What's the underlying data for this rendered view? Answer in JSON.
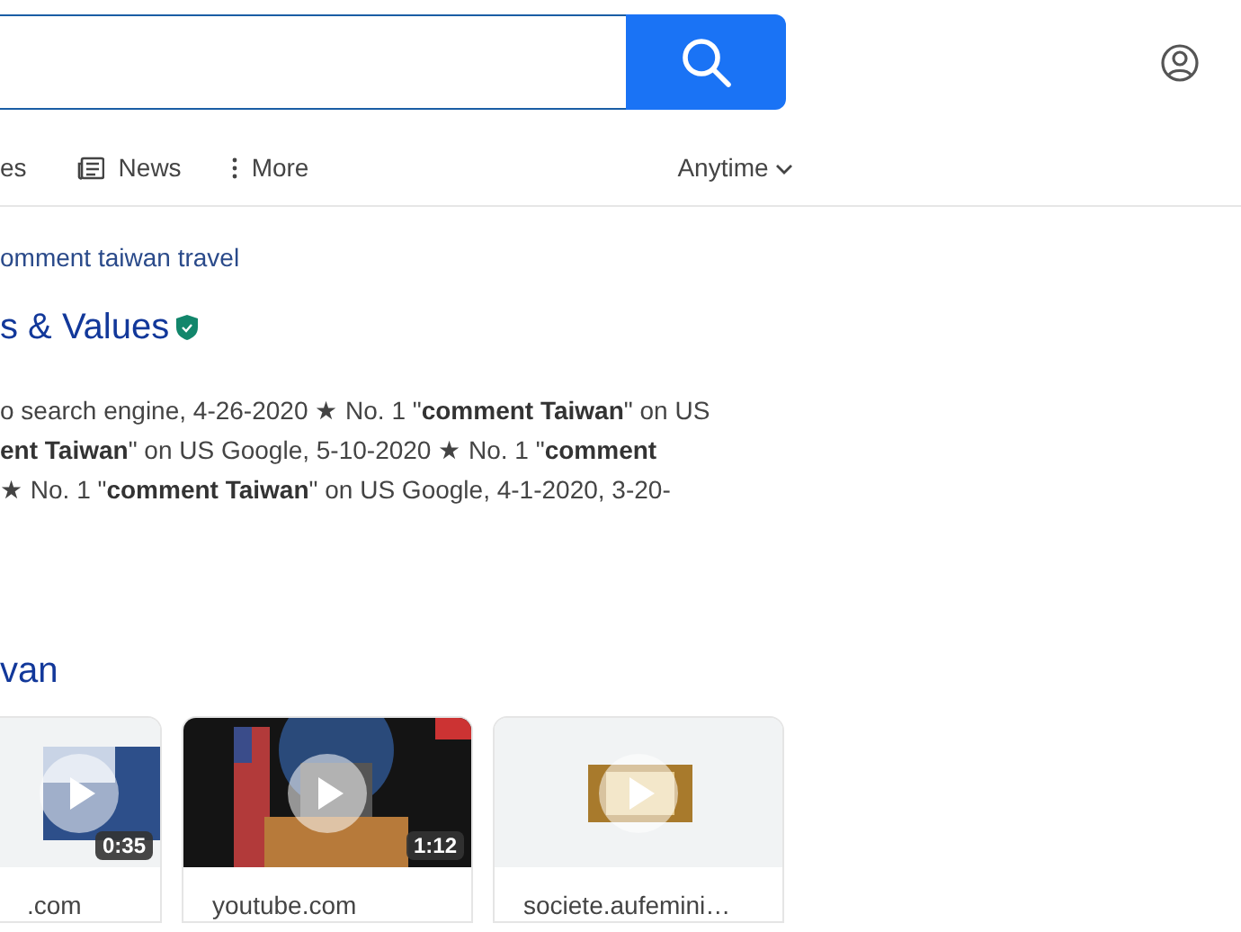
{
  "tabs": [
    {
      "label": "es",
      "kind": "text",
      "selected": false
    },
    {
      "label": "News",
      "kind": "news",
      "selected": false
    },
    {
      "label": "More",
      "kind": "more",
      "selected": false
    }
  ],
  "time_filter": {
    "label": "Anytime"
  },
  "result": {
    "breadcrumb": "omment taiwan travel",
    "title": "s & Values",
    "verified": true,
    "snippet": [
      "o search engine, 4-26-2020 ★ No. 1 \"**comment Taiwan**\" on US",
      "**ent Taiwan**\" on US Google, 5-10-2020 ★ No. 1 \"**comment**",
      "★ No. 1 \"**comment Taiwan**\" on US Google, 4-1-2020, 3-20-"
    ]
  },
  "videos_heading": "van",
  "videos": [
    {
      "domain": ".com",
      "duration": "0:35"
    },
    {
      "domain": "youtube.com",
      "duration": "1:12"
    },
    {
      "domain": "societe.aufemini…"
    }
  ]
}
